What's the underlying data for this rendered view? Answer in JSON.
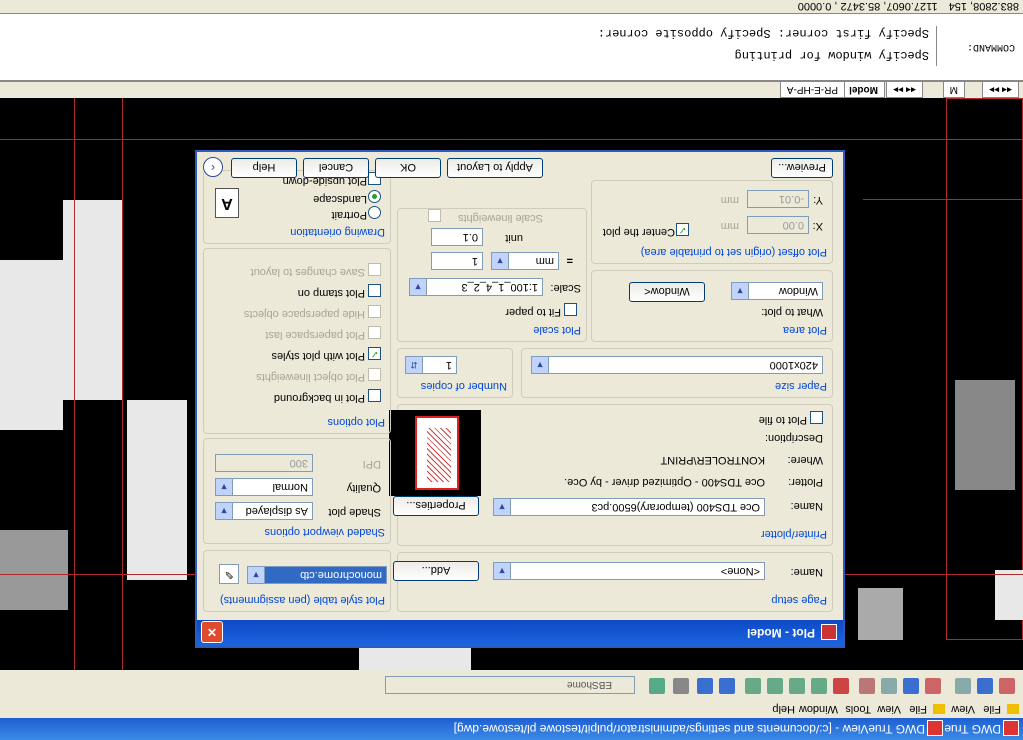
{
  "window": {
    "title": "DWG TrueView - [c:/documents and settings/administrator/pulpit/testowe pl/testowe.dwg]",
    "taskbar_title": "DWG True"
  },
  "menubar": {
    "items": [
      "File",
      "View",
      "Tools",
      "Window",
      "Help"
    ],
    "short_items": [
      "File",
      "View"
    ]
  },
  "toolbar": {
    "layer_value": "EBShome"
  },
  "layout_tabs": {
    "model": "Model",
    "layout": "PR-E-HP-A",
    "short": "M"
  },
  "command": {
    "label": "COMMAND:",
    "line1": "Specify window for printing",
    "line2": "Specify first corner: Specify opposite corner:"
  },
  "status": {
    "coords": "883.2808, 154",
    "coords2": "1127.0607, 85.3472 , 0.0000"
  },
  "dialog": {
    "title": "Plot - Model",
    "page_setup": {
      "group": "Page setup",
      "name_label": "Name:",
      "name_value": "<None>",
      "add_button": "Add..."
    },
    "printer": {
      "group": "Printer/plotter",
      "name_label": "Name:",
      "name_value": "Oce TDS400 (temporary)6500.pc3",
      "properties_button": "Properties...",
      "plotter_label": "Plotter:",
      "plotter_value": "Oce TDS400 - Optimized driver - by Oce.",
      "where_label": "Where:",
      "where_value": "KONTROLER\\PRINT",
      "description_label": "Description:",
      "plot_to_file": "Plot to file"
    },
    "paper_size": {
      "group": "Paper size",
      "value": "420x1000"
    },
    "copies": {
      "group": "Number of copies",
      "value": "1"
    },
    "plot_area": {
      "group": "Plot area",
      "what_label": "What to plot:",
      "what_value": "Window",
      "window_button": "Window<"
    },
    "plot_scale": {
      "group": "Plot scale",
      "fit_to_paper": "Fit to paper",
      "scale_label": "Scale:",
      "scale_value": "1:100_1_4_2_3",
      "scale_num": "1",
      "unit_value": "mm",
      "scale_den": "0.1",
      "unit_label": "unit",
      "scale_lineweights": "Scale lineweights"
    },
    "plot_offset": {
      "group": "Plot offset (origin set to printable area)",
      "x_label": "X:",
      "x_value": "0.00",
      "y_label": "Y:",
      "y_value": "-0.01",
      "unit": "mm",
      "center": "Center the plot"
    },
    "plot_style": {
      "group": "Plot style table (pen assignments)",
      "value": "monochrome.ctb"
    },
    "shaded": {
      "group": "Shaded viewport options",
      "shade_label": "Shade plot",
      "shade_value": "As displayed",
      "quality_label": "Quality",
      "quality_value": "Normal",
      "dpi_label": "DPI",
      "dpi_value": "300"
    },
    "plot_options": {
      "group": "Plot options",
      "items": [
        {
          "label": "Plot in background",
          "checked": false,
          "enabled": true
        },
        {
          "label": "Plot object lineweights",
          "checked": false,
          "enabled": false
        },
        {
          "label": "Plot with plot styles",
          "checked": true,
          "enabled": true
        },
        {
          "label": "Plot paperspace last",
          "checked": false,
          "enabled": false
        },
        {
          "label": "Hide paperspace objects",
          "checked": false,
          "enabled": false
        },
        {
          "label": "Plot stamp on",
          "checked": false,
          "enabled": true
        },
        {
          "label": "Save changes to layout",
          "checked": false,
          "enabled": false
        }
      ]
    },
    "orientation": {
      "group": "Drawing orientation",
      "portrait": "Portrait",
      "landscape": "Landscape",
      "upside_down": "Plot upside-down",
      "selected": "Landscape"
    },
    "buttons": {
      "preview": "Preview...",
      "apply": "Apply to Layout",
      "ok": "OK",
      "cancel": "Cancel",
      "help": "Help"
    }
  }
}
